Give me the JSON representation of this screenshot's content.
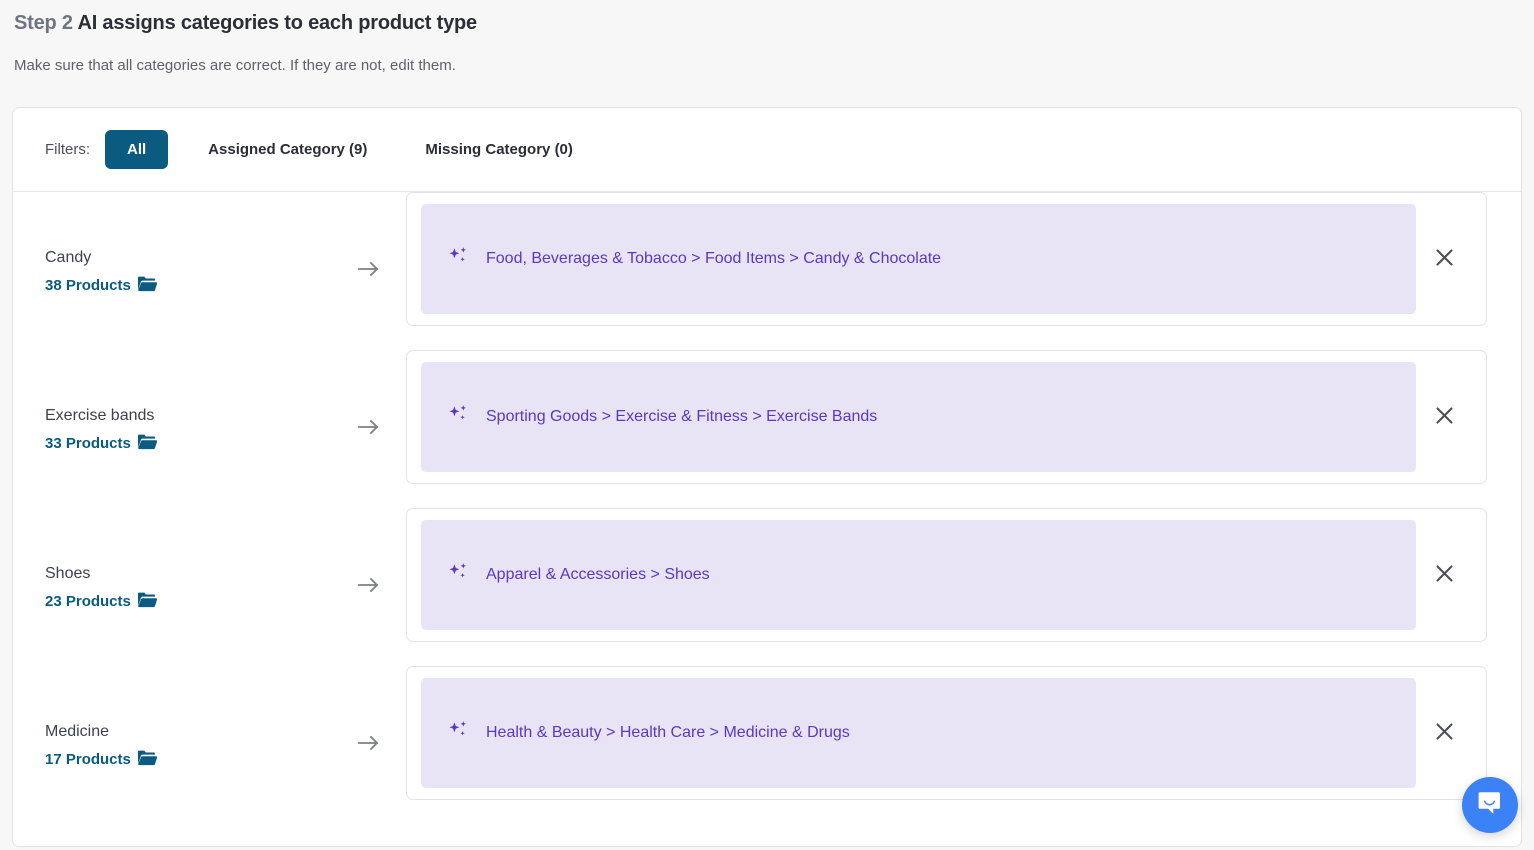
{
  "header": {
    "step_label": "Step 2",
    "title": "AI assigns categories to each product type",
    "subtitle": "Make sure that all categories are correct. If they are not, edit them."
  },
  "filters": {
    "label": "Filters:",
    "options": [
      {
        "label": "All",
        "active": true
      },
      {
        "label": "Assigned Category (9)",
        "active": false
      },
      {
        "label": "Missing Category (0)",
        "active": false
      }
    ]
  },
  "rows": [
    {
      "product_type": "Candy",
      "product_count": "38 Products",
      "category": "Food, Beverages & Tobacco > Food Items > Candy & Chocolate"
    },
    {
      "product_type": "Exercise bands",
      "product_count": "33 Products",
      "category": "Sporting Goods > Exercise & Fitness > Exercise Bands"
    },
    {
      "product_type": "Shoes",
      "product_count": "23 Products",
      "category": "Apparel & Accessories > Shoes"
    },
    {
      "product_type": "Medicine",
      "product_count": "17 Products",
      "category": "Health & Beauty > Health Care > Medicine & Drugs"
    }
  ],
  "icons": {
    "folder": "folder-open-icon",
    "arrow": "arrow-right-icon",
    "sparkle": "ai-sparkle-icon",
    "remove": "close-icon",
    "chat": "chat-bubble-icon"
  },
  "colors": {
    "accent_blue": "#0b5b80",
    "chip_background": "#e8e4f5",
    "chip_text": "#5b37c2",
    "page_background": "#f7f7f7",
    "chat_launcher": "#3b82f6"
  }
}
